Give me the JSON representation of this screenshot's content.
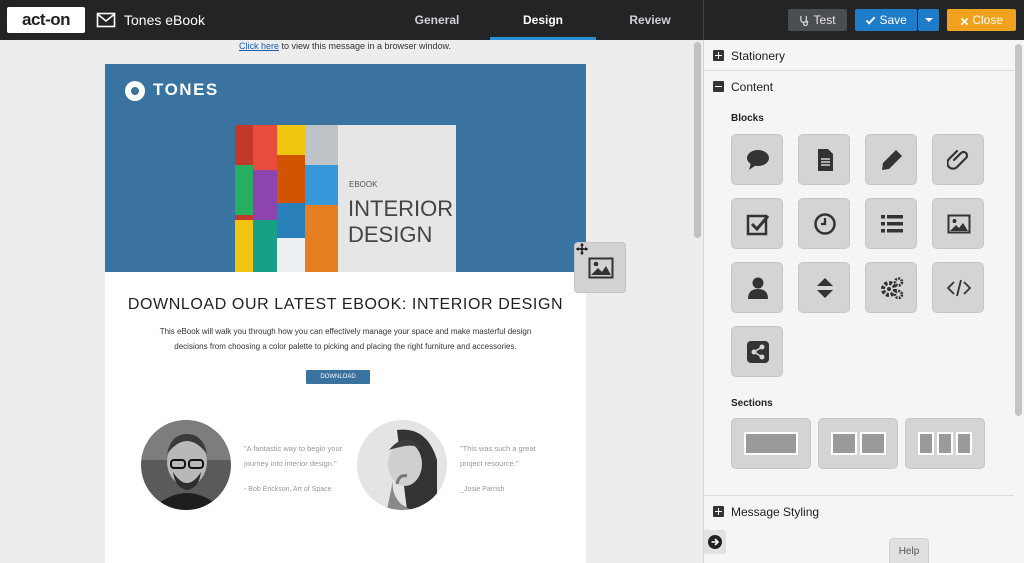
{
  "app": {
    "logo_text": "act-on",
    "document_title": "Tones eBook"
  },
  "nav": {
    "tabs": [
      {
        "label": "General"
      },
      {
        "label": "Design"
      },
      {
        "label": "Review"
      }
    ],
    "active": "Design"
  },
  "toolbar": {
    "test_label": "Test",
    "save_label": "Save",
    "close_label": "Close"
  },
  "email": {
    "browser_link": "Click here",
    "browser_link_suffix": " to view this message in a browser window.",
    "brand": "TONES",
    "book_small": "EBOOK",
    "book_title_1": "INTERIOR",
    "book_title_2": "DESIGN",
    "headline": "DOWNLOAD OUR LATEST EBOOK: INTERIOR DESIGN",
    "body_line_1": "This eBook will walk you through how you can effectively manage your space and make masterful design",
    "body_line_2": "decisions from choosing a color palette to picking and placing the right furniture and accessories.",
    "download_label": "DOWNLOAD",
    "testimonials": [
      {
        "line_1": "\"A fantastic way to begin your",
        "line_2": "journey into interior design.\"",
        "author": "- Bob Erickson, Art of Space"
      },
      {
        "line_1": "\"This was such a great",
        "line_2": "project resource.\"",
        "author": "_Josie Parrish"
      }
    ]
  },
  "panel": {
    "sections": [
      {
        "label": "Stationery",
        "expanded": false
      },
      {
        "label": "Content",
        "expanded": true
      },
      {
        "label": "Message Styling",
        "expanded": false
      }
    ],
    "blocks_label": "Blocks",
    "sections_label": "Sections",
    "blocks": [
      "speech-bubble-icon",
      "document-icon",
      "pencil-icon",
      "paperclip-icon",
      "checkbox-icon",
      "clock-icon",
      "list-icon",
      "image-icon",
      "person-icon",
      "spacer-icon",
      "gears-icon",
      "code-icon",
      "share-icon"
    ],
    "section_layouts": [
      "one-column",
      "two-column",
      "three-column"
    ],
    "help_label": "Help"
  },
  "colors": {
    "topbar": "#222426",
    "accent_blue": "#1f7cc9",
    "close_orange": "#f0a11e",
    "hero_blue": "#3a72a0"
  }
}
